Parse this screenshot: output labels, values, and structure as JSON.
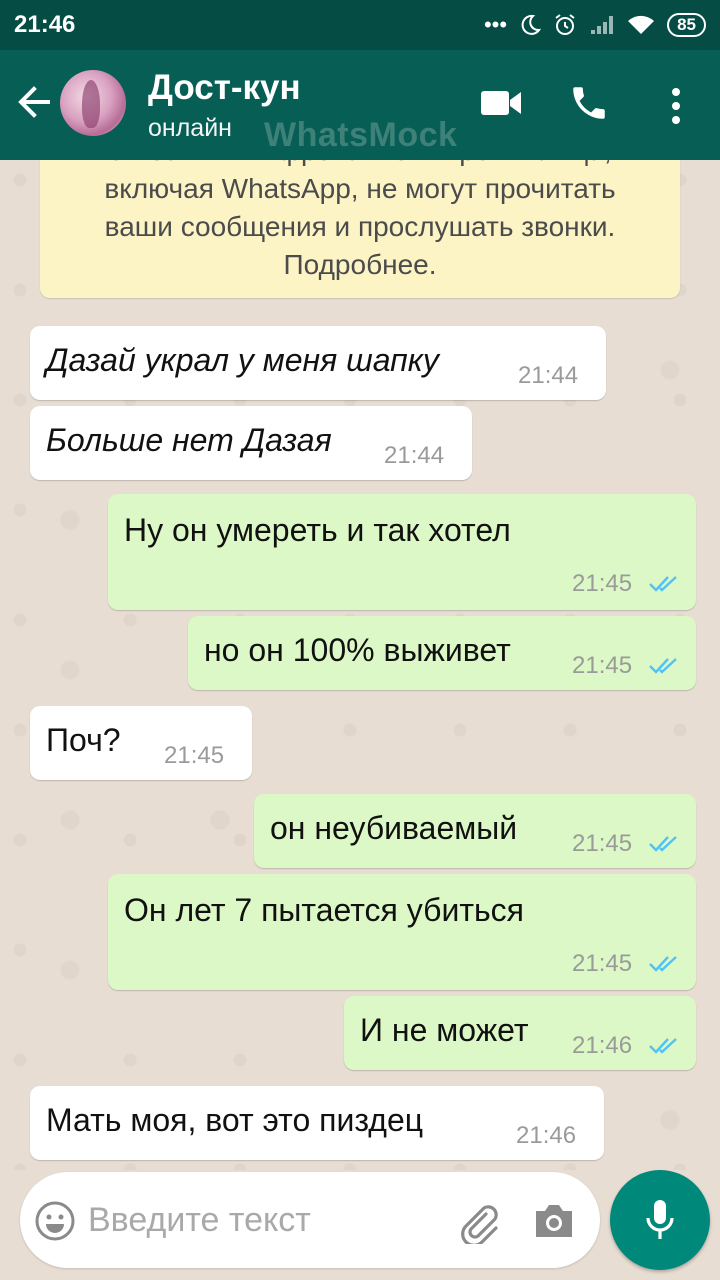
{
  "status_bar": {
    "time": "21:46",
    "battery": "85",
    "icons": [
      "more-dots-icon",
      "moon-icon",
      "alarm-icon",
      "signal-icon",
      "wifi-icon",
      "battery-icon"
    ]
  },
  "header": {
    "name": "Дост-кун",
    "status": "онлайн",
    "watermark": "WhatsMock",
    "icons": [
      "back-arrow-icon",
      "video-call-icon",
      "phone-call-icon",
      "more-vert-icon"
    ]
  },
  "notice": {
    "lines": [
      "сквозным шифрованием. Третьи лица,",
      "включая WhatsApp, не могут прочитать",
      "ваши сообщения и прослушать звонки.",
      "Подробнее."
    ]
  },
  "messages": [
    {
      "dir": "in",
      "text": "Дазай украл у меня шапку",
      "time": "21:44",
      "italic": true
    },
    {
      "dir": "in",
      "text": "Больше нет Дазая",
      "time": "21:44",
      "italic": true
    },
    {
      "dir": "out",
      "text": "Ну он умереть и так хотел",
      "time": "21:45",
      "read": true
    },
    {
      "dir": "out",
      "text": "но он 100% выживет",
      "time": "21:45",
      "read": true
    },
    {
      "dir": "in",
      "text": "Поч?",
      "time": "21:45"
    },
    {
      "dir": "out",
      "text": "он неубиваемый",
      "time": "21:45",
      "read": true
    },
    {
      "dir": "out",
      "text": "Он лет 7 пытается убиться",
      "time": "21:45",
      "read": true
    },
    {
      "dir": "out",
      "text": "И не может",
      "time": "21:46",
      "read": true
    },
    {
      "dir": "in",
      "text": "Мать моя, вот это пиздец",
      "time": "21:46"
    }
  ],
  "input": {
    "placeholder": "Введите текст"
  },
  "colors": {
    "header": "#075e54",
    "status_bar": "#054d44",
    "incoming": "#ffffff",
    "outgoing": "#dcf8c6",
    "notice": "#fdf4c5",
    "ticks": "#4fc3f7",
    "mic_button": "#00897b"
  }
}
